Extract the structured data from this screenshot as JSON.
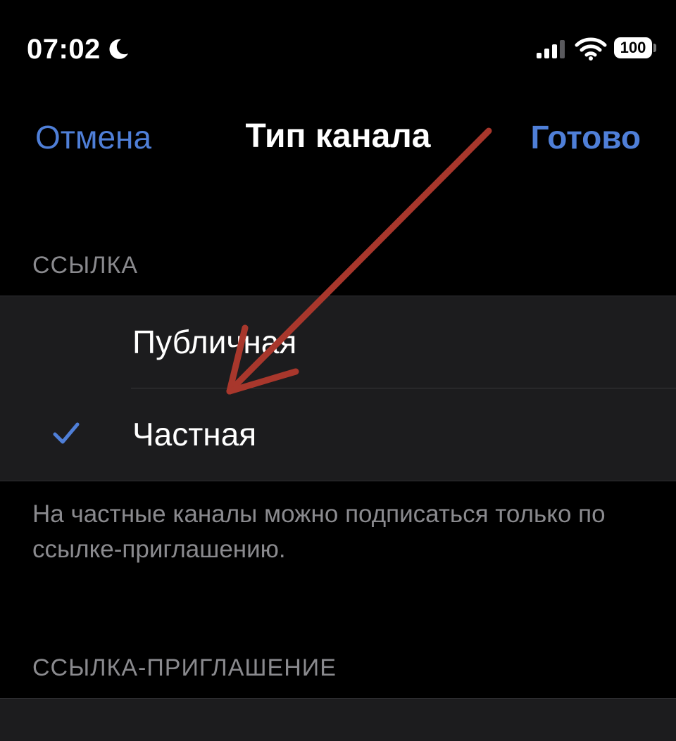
{
  "status_bar": {
    "time": "07:02",
    "battery": "100",
    "icons": [
      "moon-icon",
      "signal-icon",
      "wifi-icon",
      "battery-icon"
    ]
  },
  "nav": {
    "cancel_label": "Отмена",
    "title": "Тип канала",
    "done_label": "Готово"
  },
  "link_section": {
    "header": "ССЫЛКА",
    "options": [
      {
        "label": "Публичная",
        "selected": false
      },
      {
        "label": "Частная",
        "selected": true
      }
    ],
    "footer": "На частные каналы можно подписаться только по ссылке-приглашению."
  },
  "invite_section": {
    "header": "ССЫЛКА-ПРИГЛАШЕНИЕ"
  },
  "colors": {
    "accent": "#4f7fd8",
    "background": "#000000",
    "group_background": "#1c1c1e",
    "secondary_text": "#8a8a8e",
    "annotation_arrow": "#a8372c"
  }
}
